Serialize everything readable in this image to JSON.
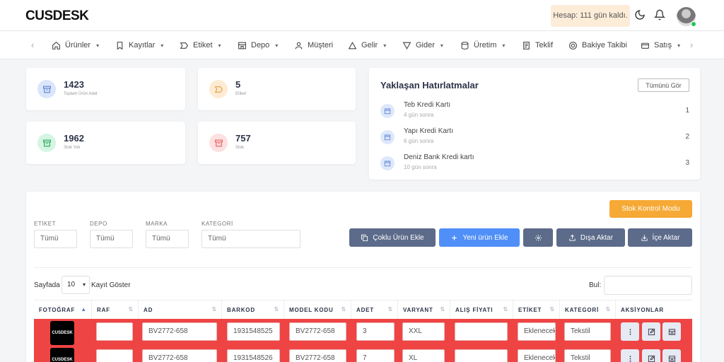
{
  "header": {
    "logo_bold": "CUSDESK",
    "logo_thin": "desk",
    "account_status": "Hesap: 111 gün kaldı."
  },
  "nav": {
    "items": [
      {
        "label": "Ürünler",
        "icon": "home-icon",
        "has_dropdown": true
      },
      {
        "label": "Kayıtlar",
        "icon": "bookmark-icon",
        "has_dropdown": true
      },
      {
        "label": "Etiket",
        "icon": "tag-icon",
        "has_dropdown": true
      },
      {
        "label": "Depo",
        "icon": "store-icon",
        "has_dropdown": true
      },
      {
        "label": "Müşteri",
        "icon": "user-icon",
        "has_dropdown": false
      },
      {
        "label": "Gelir",
        "icon": "triangle-up-icon",
        "has_dropdown": true
      },
      {
        "label": "Gider",
        "icon": "triangle-down-icon",
        "has_dropdown": true
      },
      {
        "label": "Üretim",
        "icon": "database-icon",
        "has_dropdown": true
      },
      {
        "label": "Teklif",
        "icon": "document-icon",
        "has_dropdown": false
      },
      {
        "label": "Bakiye Takibi",
        "icon": "target-icon",
        "has_dropdown": false
      },
      {
        "label": "Satış",
        "icon": "wallet-icon",
        "has_dropdown": true
      }
    ]
  },
  "stats": [
    {
      "value": "1423",
      "label": "Toplam Ürün Adet",
      "color": "#dbe6fb"
    },
    {
      "value": "5",
      "label": "Etiket",
      "color": "#fdebd3"
    },
    {
      "value": "1962",
      "label": "Stok Yok",
      "color": "#d5f5e3"
    },
    {
      "value": "757",
      "label": "Stok",
      "color": "#fde0e0"
    }
  ],
  "reminders": {
    "title": "Yaklaşan Hatırlatmalar",
    "see_all": "Tümünü Gör",
    "items": [
      {
        "title": "Teb Kredi Kartı",
        "sub": "4 gün sonra",
        "count": "1"
      },
      {
        "title": "Yapı Kredi Kartı",
        "sub": "6 gün sonra",
        "count": "2"
      },
      {
        "title": "Deniz Bank Kredi kartı",
        "sub": "10 gün sonra",
        "count": "3"
      }
    ]
  },
  "toolbar": {
    "stock_mode": "Stok Kontrol Modu",
    "bulk_add": "Çoklu Ürün Ekle",
    "new_product": "Yeni ürün Ekle",
    "export": "Dışa Aktar",
    "import": "İçe Aktar"
  },
  "filters": [
    {
      "label": "ETİKET",
      "value": "Tümü"
    },
    {
      "label": "DEPO",
      "value": "Tümü"
    },
    {
      "label": "MARKA",
      "value": "Tümü"
    },
    {
      "label": "KATEGORİ",
      "value": "Tümü"
    }
  ],
  "listing": {
    "page_prefix": "Sayfada",
    "page_size": "10",
    "page_suffix": "Kayıt Göster",
    "search_label": "Bul:"
  },
  "table": {
    "columns": [
      "FOTOĞRAF",
      "RAF",
      "AD",
      "BARKOD",
      "MODEL KODU",
      "ADET",
      "VARYANT",
      "ALIŞ FİYATI",
      "ETİKET",
      "KATEGORİ",
      "AKSİYONLAR"
    ],
    "rows": [
      {
        "photo": "CUSDESK",
        "raf": "",
        "ad": "BV2772-658",
        "barkod": "1931548525",
        "model": "BV2772-658",
        "adet": "3",
        "varyant": "XXL",
        "alis": "",
        "etiket": "Eklenecek",
        "kategori": "Tekstil"
      },
      {
        "photo": "CUSDESK",
        "raf": "",
        "ad": "BV2772-658",
        "barkod": "1931548526",
        "model": "BV2772-658",
        "adet": "7",
        "varyant": "XL",
        "alis": "",
        "etiket": "Eklenecek",
        "kategori": "Tekstil"
      }
    ],
    "row_color": "#ef4444"
  }
}
